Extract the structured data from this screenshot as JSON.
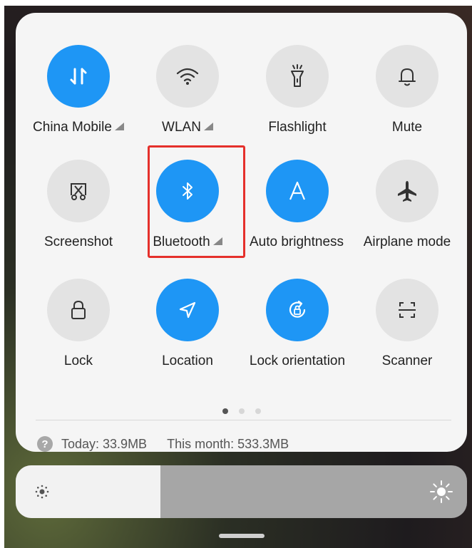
{
  "tiles": [
    {
      "label": "China Mobile",
      "icon": "mobile-data-icon",
      "active": true,
      "arrow": true
    },
    {
      "label": "WLAN",
      "icon": "wifi-icon",
      "active": false,
      "arrow": true
    },
    {
      "label": "Flashlight",
      "icon": "flashlight-icon",
      "active": false,
      "arrow": false
    },
    {
      "label": "Mute",
      "icon": "bell-icon",
      "active": false,
      "arrow": false
    },
    {
      "label": "Screenshot",
      "icon": "screenshot-icon",
      "active": false,
      "arrow": false
    },
    {
      "label": "Bluetooth",
      "icon": "bluetooth-icon",
      "active": true,
      "arrow": true
    },
    {
      "label": "Auto brightness",
      "icon": "auto-brightness-icon",
      "active": true,
      "arrow": false
    },
    {
      "label": "Airplane mode",
      "icon": "airplane-icon",
      "active": false,
      "arrow": false
    },
    {
      "label": "Lock",
      "icon": "lock-icon",
      "active": false,
      "arrow": false
    },
    {
      "label": "Location",
      "icon": "location-icon",
      "active": true,
      "arrow": false
    },
    {
      "label": "Lock orientation",
      "icon": "rotation-lock-icon",
      "active": true,
      "arrow": false
    },
    {
      "label": "Scanner",
      "icon": "scanner-icon",
      "active": false,
      "arrow": false
    }
  ],
  "page_indicator": {
    "count": 3,
    "active": 0
  },
  "usage": {
    "help_glyph": "?",
    "today": "Today: 33.9MB",
    "month": "This month: 533.3MB"
  },
  "brightness": {
    "level": 0.32
  },
  "colors": {
    "active": "#1e96f5",
    "inactive": "#e3e3e3",
    "highlight": "#e5302b"
  }
}
